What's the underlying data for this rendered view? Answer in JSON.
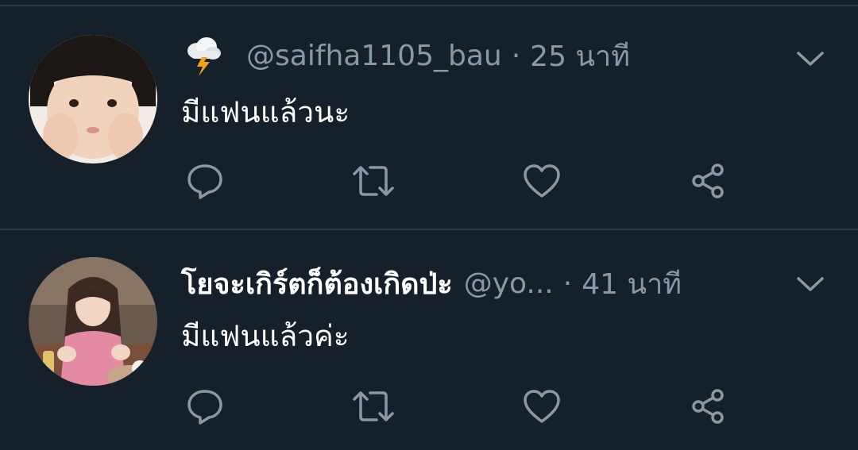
{
  "colors": {
    "background": "#15202b",
    "divider": "#2f3b47",
    "secondary_text": "#8899a6",
    "primary_text": "#ffffff"
  },
  "tweets": [
    {
      "display_name": "",
      "name_icon": "cloud-lightning-icon",
      "handle": "@saifha1105_bau",
      "separator": "·",
      "time": "25 นาที",
      "text": "มีแฟนแล้วนะ",
      "avatar": "avatar-child-photo"
    },
    {
      "display_name": "โยจะเกิร์ตก็ต้องเกิดป่ะ",
      "handle": "@yo...",
      "separator": "·",
      "time": "41 นาที",
      "text": "มีแฟนแล้วค่ะ",
      "avatar": "avatar-girl-photo"
    }
  ],
  "icons": {
    "menu": "chevron-down-icon",
    "reply": "reply-icon",
    "retweet": "retweet-icon",
    "like": "heart-icon",
    "share": "share-icon"
  }
}
